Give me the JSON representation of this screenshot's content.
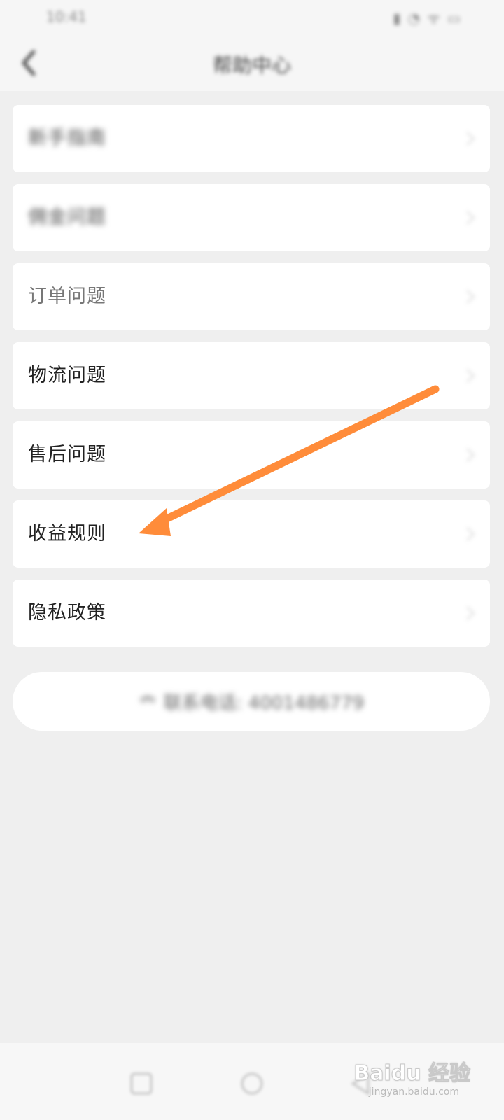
{
  "status_bar": {
    "time": "10:41",
    "icons": "▮ ◔ ᯤ ▭"
  },
  "header": {
    "title": "帮助中心"
  },
  "menu": {
    "items": [
      {
        "label": "新手指南",
        "blurred": true
      },
      {
        "label": "佣金问题",
        "blurred": true
      },
      {
        "label": "订单问题",
        "blurred": false
      },
      {
        "label": "物流问题",
        "blurred": false
      },
      {
        "label": "售后问题",
        "blurred": false
      },
      {
        "label": "收益规则",
        "blurred": false
      },
      {
        "label": "隐私政策",
        "blurred": false
      }
    ]
  },
  "contact": {
    "label": "联系电话: 4001486779"
  },
  "annotation": {
    "color": "#ff8c3a"
  },
  "watermark": {
    "brand": "Baidu 经验",
    "url": "jingyan.baidu.com"
  }
}
